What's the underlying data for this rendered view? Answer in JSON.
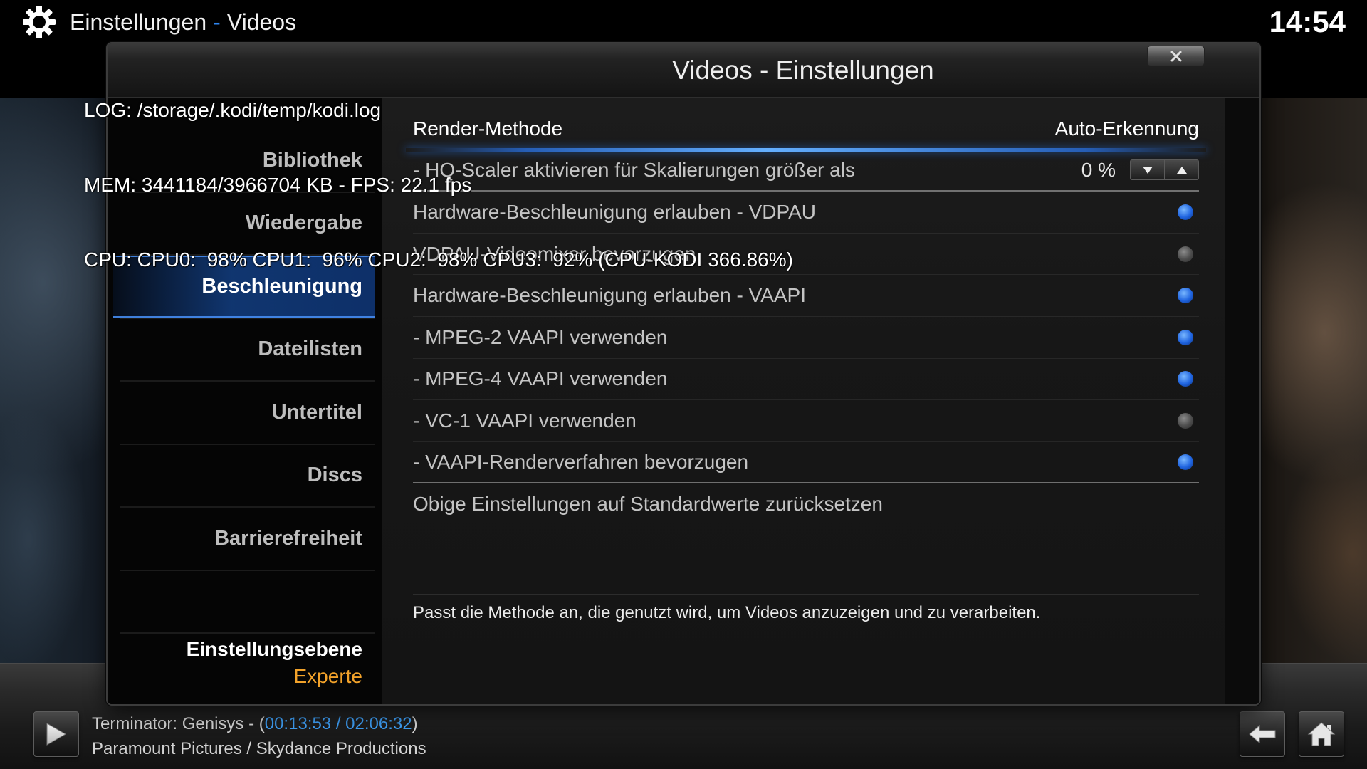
{
  "header": {
    "icon": "gear-icon",
    "title": "Einstellungen",
    "separator": "-",
    "subtitle": "Videos",
    "clock": "14:54"
  },
  "debug": {
    "log": "LOG: /storage/.kodi/temp/kodi.log",
    "mem": "MEM: 3441184/3966704 KB - FPS: 22.1 fps",
    "cpu": "CPU: CPU0:  98% CPU1:  96% CPU2:  98% CPU3:  92% (CPU-KODI 366.86%)"
  },
  "dialog": {
    "title": "Videos - Einstellungen",
    "close_icon": "close-icon"
  },
  "sidebar": {
    "items": [
      {
        "label": "Bibliothek",
        "selected": false
      },
      {
        "label": "Wiedergabe",
        "selected": false
      },
      {
        "label": "Beschleunigung",
        "selected": true
      },
      {
        "label": "Dateilisten",
        "selected": false
      },
      {
        "label": "Untertitel",
        "selected": false
      },
      {
        "label": "Discs",
        "selected": false
      },
      {
        "label": "Barrierefreiheit",
        "selected": false
      }
    ],
    "level_label": "Einstellungsebene",
    "level_value": "Experte"
  },
  "settings": {
    "rows": [
      {
        "label": "Render-Methode",
        "value": "Auto-Erkennung",
        "focused": true
      },
      {
        "label": "- HQ-Scaler aktivieren für Skalierungen größer als",
        "value": "0 %"
      },
      {
        "label": "Hardware-Beschleunigung erlauben - VDPAU",
        "enabled": true
      },
      {
        "label": "VDPAU-Videomixer bevorzugen",
        "enabled": false
      },
      {
        "label": "Hardware-Beschleunigung erlauben - VAAPI",
        "enabled": true
      },
      {
        "label": "- MPEG-2 VAAPI verwenden",
        "enabled": true
      },
      {
        "label": "- MPEG-4 VAAPI verwenden",
        "enabled": true
      },
      {
        "label": "- VC-1 VAAPI verwenden",
        "enabled": false
      },
      {
        "label": "- VAAPI-Renderverfahren bevorzugen",
        "enabled": true
      },
      {
        "label": "Obige Einstellungen auf Standardwerte zurücksetzen"
      }
    ],
    "description": "Passt die Methode an, die genutzt wird, um Videos anzuzeigen und zu verarbeiten."
  },
  "now_playing": {
    "play_icon": "play-icon",
    "title": "Terminator: Genisys",
    "time_open": " - (",
    "time": "00:13:53 / 02:06:32",
    "time_close": ")",
    "studio": "Paramount Pictures / Skydance Productions"
  },
  "navigation": {
    "back_icon": "back-arrow-icon",
    "home_icon": "home-icon"
  },
  "colors": {
    "accent": "#1f64e0",
    "separator": "#2f86f0",
    "level_value": "#f2a22a",
    "time": "#3d9cf2"
  }
}
